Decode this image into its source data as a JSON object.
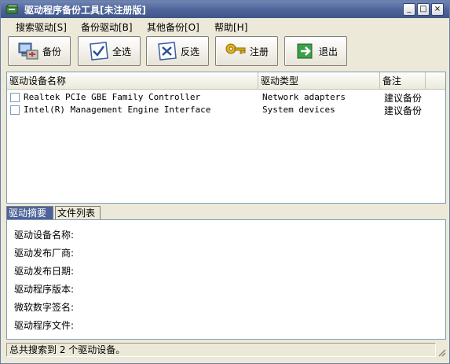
{
  "window": {
    "title": "驱动程序备份工具[未注册版]"
  },
  "title_buttons": {
    "minimize": "_",
    "maximize": "□",
    "close": "×"
  },
  "menu": [
    {
      "label": "搜索驱动[S]"
    },
    {
      "label": "备份驱动[B]"
    },
    {
      "label": "其他备份[O]"
    },
    {
      "label": "帮助[H]"
    }
  ],
  "toolbar": {
    "backup": "备份",
    "select_all": "全选",
    "invert": "反选",
    "register": "注册",
    "exit": "退出"
  },
  "list": {
    "columns": [
      "驱动设备名称",
      "驱动类型",
      "备注"
    ],
    "rows": [
      {
        "name": "Realtek PCIe GBE Family Controller",
        "type": "Network adapters",
        "note": "建议备份",
        "checked": false
      },
      {
        "name": "Intel(R) Management Engine Interface",
        "type": "System devices",
        "note": "建议备份",
        "checked": false
      }
    ]
  },
  "tabs": [
    "驱动摘要",
    "文件列表"
  ],
  "details": {
    "device_name": "驱动设备名称:",
    "vendor": "驱动发布厂商:",
    "date": "驱动发布日期:",
    "version": "驱动程序版本:",
    "signer": "微软数字签名:",
    "files": "驱动程序文件:"
  },
  "status": {
    "text": "总共搜索到 2 个驱动设备。"
  },
  "colors": {
    "titlebar": "#4d6399",
    "panel_border": "#7f9db9",
    "face": "#ece9d8"
  }
}
